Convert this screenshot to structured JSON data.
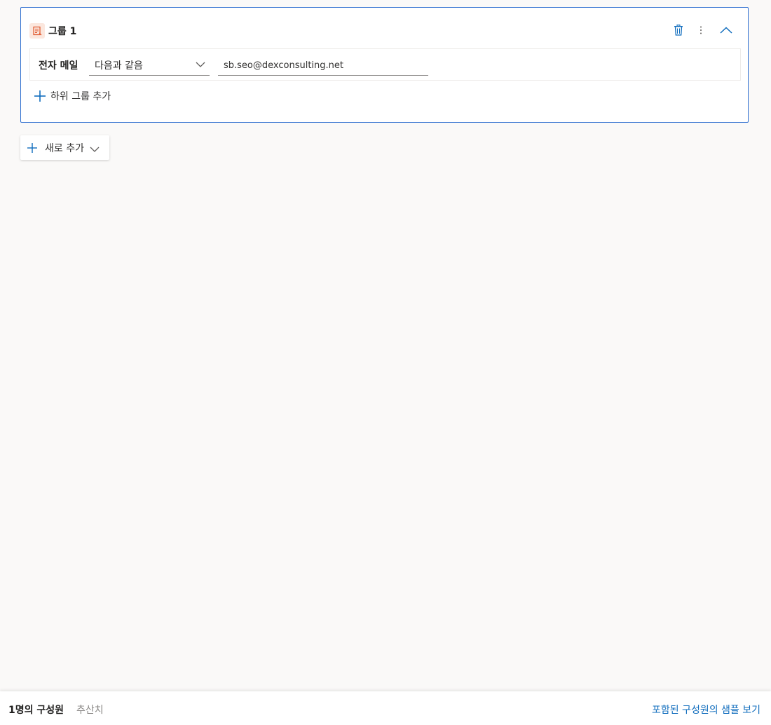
{
  "colors": {
    "accent": "#0f6cbd",
    "card_border": "#2f6fd0",
    "group_icon": "#e0562c",
    "background": "#faf9f8"
  },
  "group": {
    "icon": "rules-document-icon",
    "title": "그룹 1",
    "actions": {
      "delete_icon": "trash-icon",
      "more_icon": "more-vertical-icon",
      "collapse_icon": "chevron-up-icon"
    },
    "rule": {
      "field_label": "전자 메일",
      "operator": "다음과 같음",
      "value": "sb.seo@dexconsulting.net"
    },
    "add_subgroup_label": "하위 그룹 추가"
  },
  "add_new": {
    "label": "새로 추가"
  },
  "footer": {
    "member_count": "1명의 구성원",
    "estimate": "추산치",
    "sample_link": "포함된 구성원의 샘플 보기"
  }
}
